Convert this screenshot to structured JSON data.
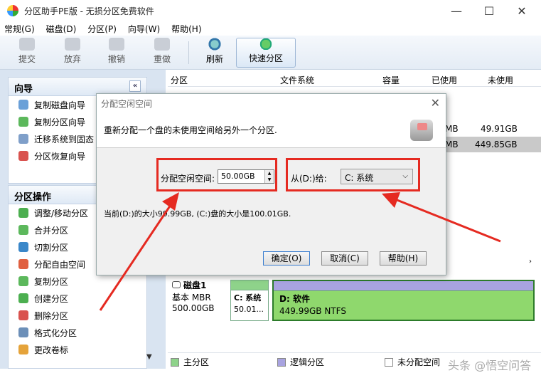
{
  "window": {
    "title": "分区助手PE版 - 无损分区免费软件",
    "minimize": "—",
    "maximize": "☐",
    "close": "✕"
  },
  "menu": [
    "常规(G)",
    "磁盘(D)",
    "分区(P)",
    "向导(W)",
    "帮助(H)"
  ],
  "toolbar": {
    "commit": "提交",
    "discard": "放弃",
    "undo": "撤销",
    "redo": "重做",
    "refresh": "刷新",
    "quick": "快速分区"
  },
  "wizards": {
    "title": "向导",
    "collapse": "«",
    "items": [
      "复制磁盘向导",
      "复制分区向导",
      "迁移系统到固态",
      "分区恢复向导"
    ]
  },
  "operations": {
    "title": "分区操作",
    "items": [
      "调整/移动分区",
      "合并分区",
      "切割分区",
      "分配自由空间",
      "复制分区",
      "创建分区",
      "删除分区",
      "格式化分区",
      "更改卷标"
    ]
  },
  "table": {
    "headers": [
      "分区",
      "文件系统",
      "容量",
      "已使用",
      "未使用"
    ],
    "rows": [
      {
        "used_tail": "MB",
        "free": "49.91GB"
      },
      {
        "used_tail": "MB",
        "free": "449.85GB"
      }
    ]
  },
  "disk": {
    "name": "磁盘1",
    "type": "基本 MBR",
    "size": "500.00GB"
  },
  "partitions": [
    {
      "name": "C: 系统",
      "size": "50.01..."
    },
    {
      "name": "D: 软件",
      "size": "449.99GB NTFS"
    }
  ],
  "legend": {
    "primary": "主分区",
    "logical": "逻辑分区",
    "unallocated": "未分配空间"
  },
  "watermark": "头条 @悟空问答",
  "dialog": {
    "title": "分配空闲空间",
    "description": "重新分配一个盘的未使用空间给另外一个分区.",
    "alloc_label": "分配空闲空间:",
    "alloc_value": "50.00GB",
    "from_label": "从(D:)给:",
    "target": "C: 系统",
    "status_prefix": "当前(D:)的大小",
    "status_suffix": "99.99GB, (C:)盘的大小是100.01GB.",
    "ok": "确定(O)",
    "cancel": "取消(C)",
    "help": "帮助(H)"
  },
  "colors": {
    "annotation": "#e52a21",
    "primary_partition": "#8ed38a",
    "logical_partition": "#a8a3e0",
    "selected_row": "#c9c9c9"
  }
}
